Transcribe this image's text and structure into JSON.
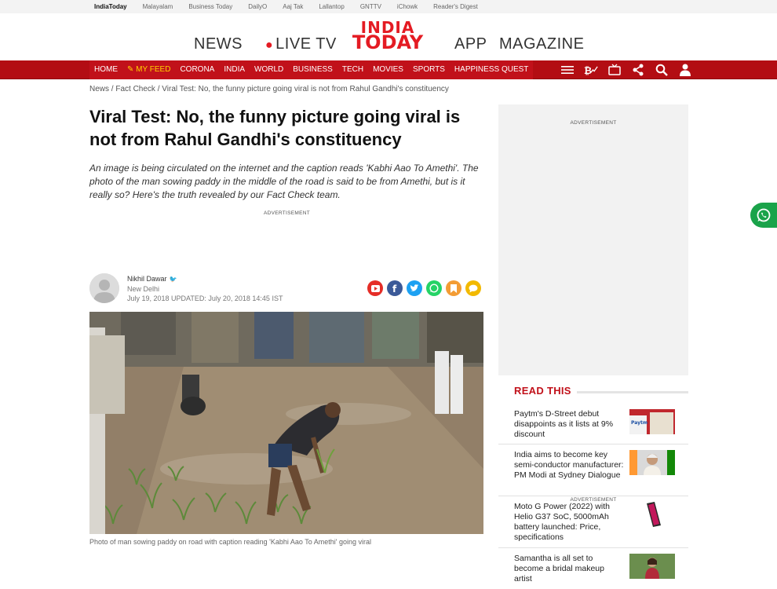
{
  "topstrip": {
    "items": [
      "IndiaToday",
      "Malayalam",
      "Business Today",
      "DailyO",
      "Aaj Tak",
      "Lallantop",
      "GNTTV",
      "iChowk",
      "Reader's Digest"
    ]
  },
  "masthead": {
    "news": "NEWS",
    "live": "LIVE TV",
    "logo_line1": "INDIA",
    "logo_line2": "TODAY",
    "app": "APP",
    "magazine": "MAGAZINE"
  },
  "nav": {
    "items": [
      "HOME",
      "MY FEED",
      "CORONA",
      "INDIA",
      "WORLD",
      "BUSINESS",
      "TECH",
      "MOVIES",
      "SPORTS",
      "HAPPINESS QUEST"
    ],
    "icons": [
      "menu-icon",
      "crypto-icon",
      "tv-icon",
      "share-icon",
      "search-icon",
      "user-icon"
    ]
  },
  "breadcrumb": {
    "news": "News",
    "sep": " / ",
    "fact_check": "Fact Check",
    "current": "Viral Test: No, the funny picture going viral is not from Rahul Gandhi's constituency"
  },
  "article": {
    "headline": "Viral Test: No, the funny picture going viral is not from Rahul Gandhi's constituency",
    "summary": "An image is being circulated on the internet and the caption reads 'Kabhi Aao To Amethi'. The photo of the man sowing paddy in the middle of the road is said to be from Amethi, but is it really so? Here's the truth revealed by our Fact Check team.",
    "advertisement": "ADVERTISEMENT",
    "author_name": "Nikhil Dawar",
    "author_location": "New Delhi",
    "dateline": "July 19, 2018 UPDATED: July 20, 2018 14:45 IST",
    "caption": "Photo of man sowing paddy on road with caption reading 'Kabhi Aao To Amethi' going viral",
    "share_icons": [
      "youtube-icon",
      "facebook-icon",
      "twitter-icon",
      "whatsapp-icon",
      "bookmark-icon",
      "comment-icon"
    ],
    "share_colors": [
      "#e52d27",
      "#3b5998",
      "#1da1f2",
      "#25d366",
      "#f39c34",
      "#f2b900"
    ]
  },
  "sidebar": {
    "advertisement_top": "ADVERTISEMENT",
    "read_this": "READ THIS",
    "stories": [
      {
        "title": "Paytm's D-Street debut disappoints as it lists at 9% discount"
      },
      {
        "title": "India aims to become key semi-conductor manufacturer: PM Modi at Sydney Dialogue"
      },
      {
        "title": "Moto G Power (2022) with Helio G37 SoC, 5000mAh battery launched: Price, specifications"
      },
      {
        "title": "Samantha is all set to become a bridal makeup artist"
      }
    ],
    "advertisement_bottom": "ADVERTISEMENT"
  },
  "colors": {
    "brand_red": "#c1111a",
    "nav_bg": "#b30d13",
    "feed_yellow": "#ffd200",
    "whatsapp_green": "#1aa34a"
  }
}
